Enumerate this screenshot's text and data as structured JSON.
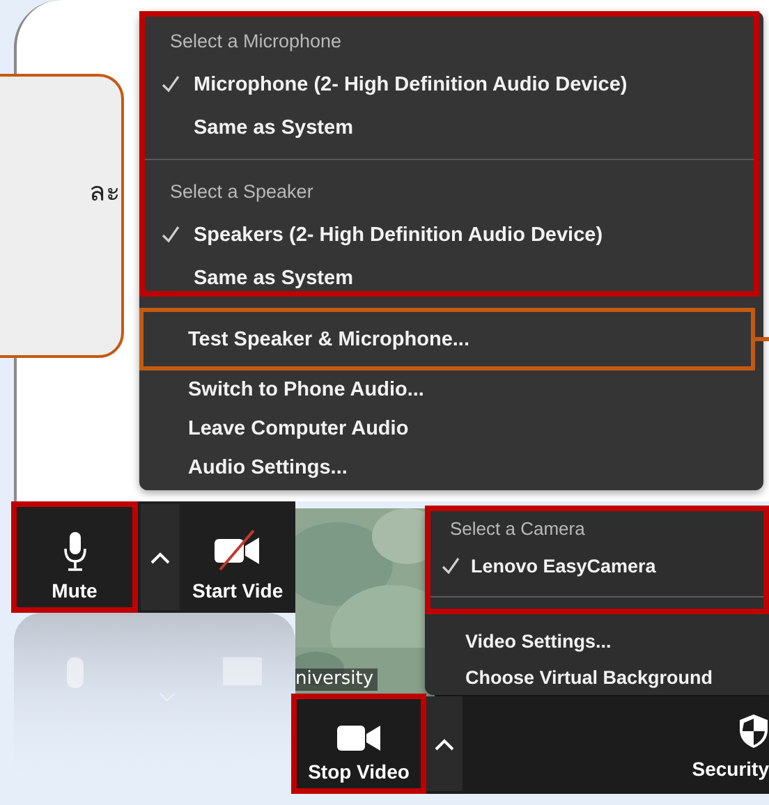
{
  "callout": {
    "text": "ละ"
  },
  "audio_menu": {
    "sections": [
      {
        "header": "Select a Microphone",
        "items": [
          {
            "label": "Microphone (2- High Definition Audio Device)",
            "selected": true
          },
          {
            "label": "Same as System",
            "selected": false
          }
        ]
      },
      {
        "header": "Select a Speaker",
        "items": [
          {
            "label": "Speakers (2- High Definition Audio Device)",
            "selected": true
          },
          {
            "label": "Same as System",
            "selected": false
          }
        ]
      }
    ],
    "actions": [
      {
        "label": "Test Speaker & Microphone...",
        "highlighted": true
      },
      {
        "label": "Switch to Phone Audio...",
        "highlighted": false
      },
      {
        "label": "Leave Computer Audio",
        "highlighted": false
      },
      {
        "label": "Audio Settings...",
        "highlighted": false
      }
    ]
  },
  "toolbar": {
    "buttons": [
      {
        "kind": "mute",
        "label": "Mute",
        "highlighted": true
      },
      {
        "kind": "start_video",
        "label": "Start Vide",
        "highlighted": false
      }
    ]
  },
  "video_tile": {
    "name": "niversity"
  },
  "camera_menu": {
    "header": "Select a Camera",
    "cameras": [
      {
        "label": "Lenovo EasyCamera",
        "selected": true
      }
    ],
    "actions": [
      "Video Settings...",
      "Choose Virtual Background"
    ]
  },
  "video_toolbar": {
    "buttons": [
      {
        "kind": "stop_video",
        "label": "Stop Video",
        "highlighted": true
      },
      {
        "kind": "security",
        "label": "Security",
        "highlighted": false
      }
    ]
  }
}
